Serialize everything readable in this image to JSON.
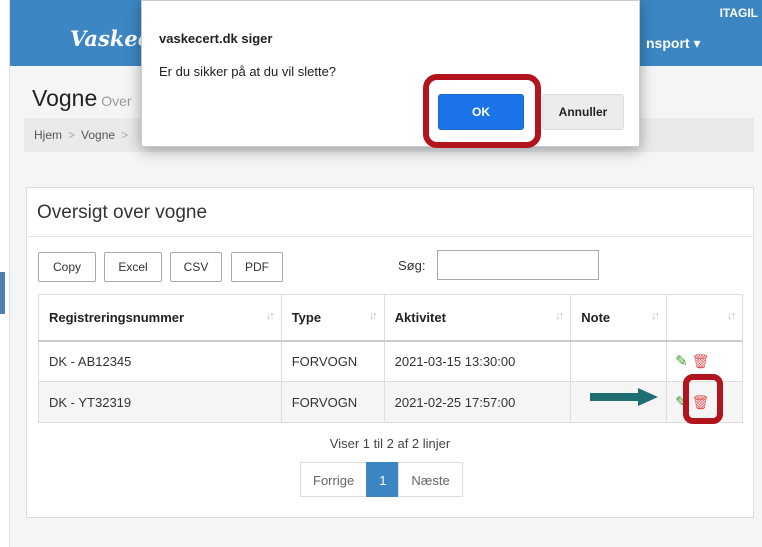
{
  "navbar": {
    "brand": "Vaskecert",
    "menu_item": "nsport",
    "user": "ITAGIL",
    "bg_color": "#3b86c3"
  },
  "page": {
    "title": "Vogne",
    "subtitle": "Over",
    "breadcrumb": [
      "Hjem",
      "Vogne"
    ]
  },
  "panel": {
    "title": "Oversigt over vogne",
    "buttons": {
      "copy": "Copy",
      "excel": "Excel",
      "csv": "CSV",
      "pdf": "PDF"
    },
    "search": {
      "label": "Søg:",
      "value": ""
    },
    "table": {
      "headers": [
        "Registreringsnummer",
        "Type",
        "Aktivitet",
        "Note",
        ""
      ],
      "rows": [
        {
          "reg": "DK - AB12345",
          "type": "FORVOGN",
          "activity": "2021-03-15 13:30:00",
          "note": ""
        },
        {
          "reg": "DK - YT32319",
          "type": "FORVOGN",
          "activity": "2021-02-25 17:57:00",
          "note": ""
        }
      ]
    },
    "info": "Viser 1 til 2 af 2 linjer",
    "pagination": {
      "prev": "Forrige",
      "current": "1",
      "next": "Næste"
    }
  },
  "dialog": {
    "title": "vaskecert.dk siger",
    "message": "Er du sikker på at du vil slette?",
    "ok": "OK",
    "cancel": "Annuller",
    "ok_color": "#1a73e8"
  },
  "icons": {
    "sort": "sort-icon",
    "edit": "pencil-icon",
    "delete": "trash-icon",
    "pointer": "arrow-right-icon",
    "highlight_color": "#b1141c",
    "arrow_color": "#1f6e73"
  }
}
